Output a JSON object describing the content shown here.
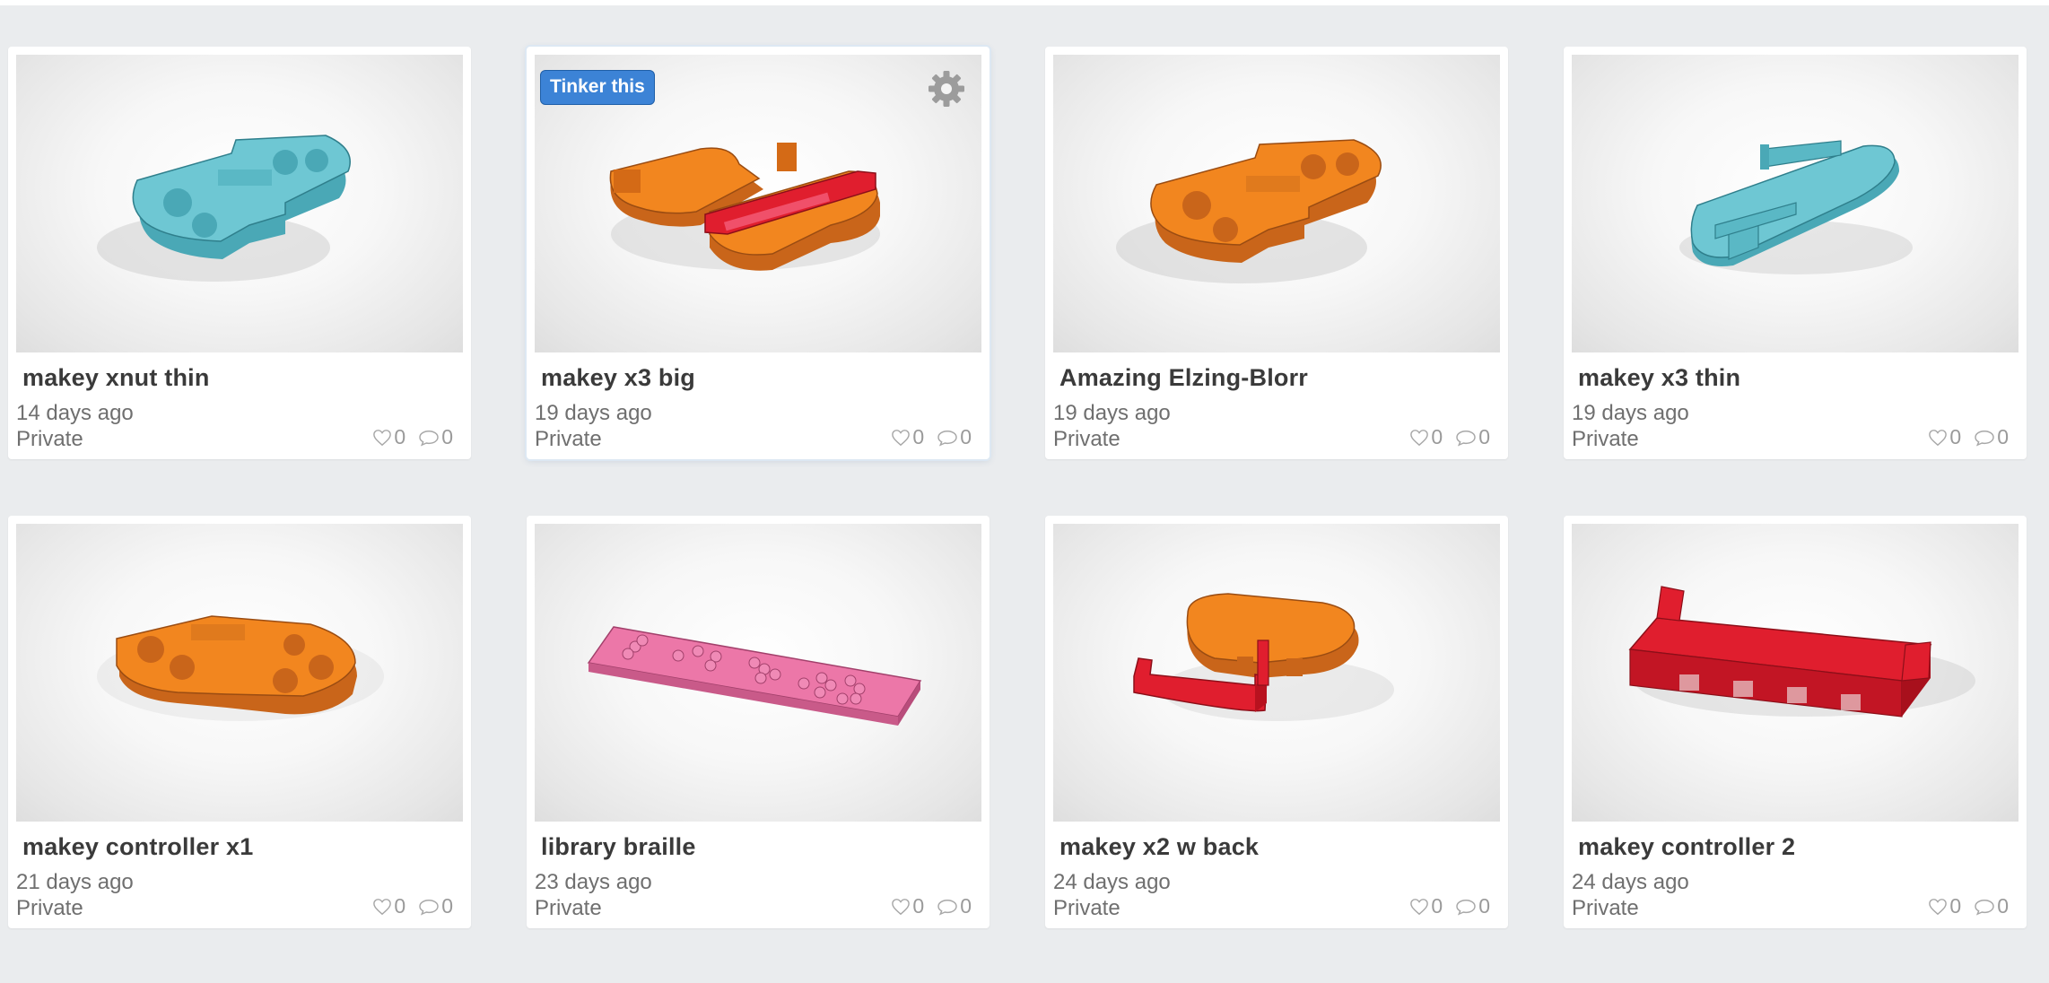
{
  "designs": [
    {
      "title": "makey xnut thin",
      "date": "14 days ago",
      "privacy": "Private",
      "likes": "0",
      "comments": "0",
      "model": "teal-nut"
    },
    {
      "title": "makey x3 big",
      "date": "19 days ago",
      "privacy": "Private",
      "likes": "0",
      "comments": "0",
      "model": "orange-red-pair"
    },
    {
      "title": "Amazing Elzing-Blorr",
      "date": "19 days ago",
      "privacy": "Private",
      "likes": "0",
      "comments": "0",
      "model": "orange-nut"
    },
    {
      "title": "makey x3 thin",
      "date": "19 days ago",
      "privacy": "Private",
      "likes": "0",
      "comments": "0",
      "model": "teal-plate"
    },
    {
      "title": "makey controller x1",
      "date": "21 days ago",
      "privacy": "Private",
      "likes": "0",
      "comments": "0",
      "model": "orange-controller"
    },
    {
      "title": "library braille",
      "date": "23 days ago",
      "privacy": "Private",
      "likes": "0",
      "comments": "0",
      "model": "pink-braille"
    },
    {
      "title": "makey x2 w back",
      "date": "24 days ago",
      "privacy": "Private",
      "likes": "0",
      "comments": "0",
      "model": "orange-with-red-back"
    },
    {
      "title": "makey controller 2",
      "date": "24 days ago",
      "privacy": "Private",
      "likes": "0",
      "comments": "0",
      "model": "red-tray"
    }
  ],
  "hover_card": {
    "tinker_label": "Tinker this",
    "settings_icon": "gear-icon"
  },
  "icons": {
    "likes": "heart-icon",
    "comments": "comment-icon"
  },
  "colors": {
    "background": "#eaecee",
    "card": "#ffffff",
    "title": "#3a3a3a",
    "meta": "#6f6f6f",
    "tinker_button": "#3c83d6",
    "teal": "#67c3d0",
    "orange": "#f07f1c",
    "red": "#e01e2e",
    "pink": "#ec77a8"
  }
}
